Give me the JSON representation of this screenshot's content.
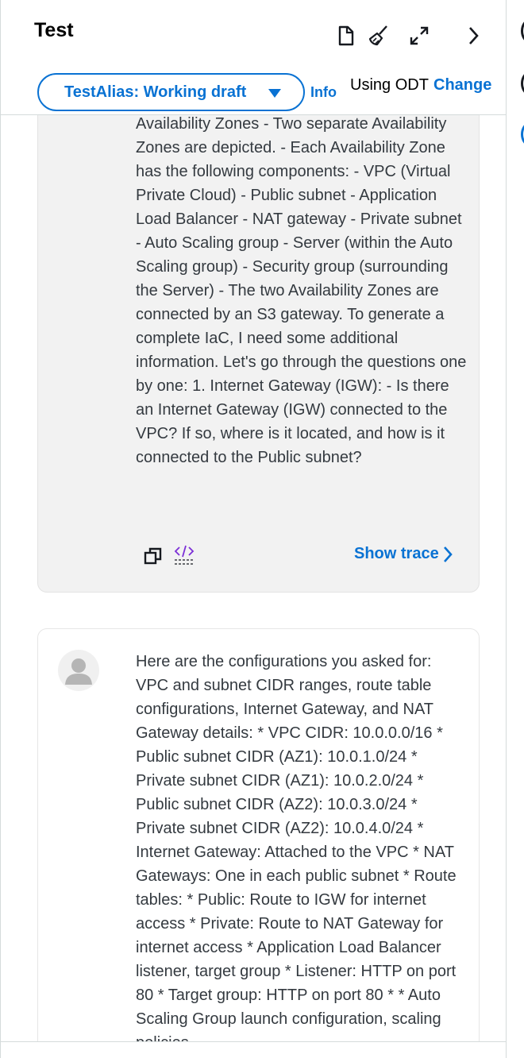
{
  "header": {
    "title": "Test",
    "alias_button": "TestAlias: Working draft",
    "info_link": "Info",
    "using_label": "Using ODT",
    "change_link": "Change"
  },
  "icons": {
    "document": "document-icon",
    "broom": "clear-broom-icon",
    "expand": "expand-icon",
    "chevron": "chevron-right-icon",
    "copy": "copy-icon",
    "code": "code-icon",
    "avatar": "user-avatar-icon"
  },
  "messages": {
    "agent_text": "Availability Zones - Two separate Availability Zones are depicted. - Each Availability Zone has the following components: - VPC (Virtual Private Cloud) - Public subnet - Application Load Balancer - NAT gateway - Private subnet - Auto Scaling group - Server (within the Auto Scaling group) - Security group (surrounding the Server) - The two Availability Zones are connected by an S3 gateway. To generate a complete IaC, I need some additional information. Let's go through the questions one by one: 1. Internet Gateway (IGW): - Is there an Internet Gateway (IGW) connected to the VPC? If so, where is it located, and how is it connected to the Public subnet?",
    "show_trace": "Show trace",
    "user_text": "Here are the configurations you asked for: VPC and subnet CIDR ranges, route table configurations, Internet Gateway, and NAT Gateway details: * VPC CIDR: 10.0.0.0/16 * Public subnet CIDR (AZ1): 10.0.1.0/24 * Private subnet CIDR (AZ1): 10.0.2.0/24 * Public subnet CIDR (AZ2): 10.0.3.0/24 * Private subnet CIDR (AZ2): 10.0.4.0/24 * Internet Gateway: Attached to the VPC * NAT Gateways: One in each public subnet * Route tables: * Public: Route to IGW for internet access * Private: Route to NAT Gateway for internet access * Application Load Balancer listener, target group * Listener: HTTP on port 80 * Target group: HTTP on port 80 * * Auto Scaling Group launch configuration, scaling policies"
  },
  "colors": {
    "accent": "#0972d3",
    "text": "#16191f",
    "bubble": "#f2f2f2"
  }
}
